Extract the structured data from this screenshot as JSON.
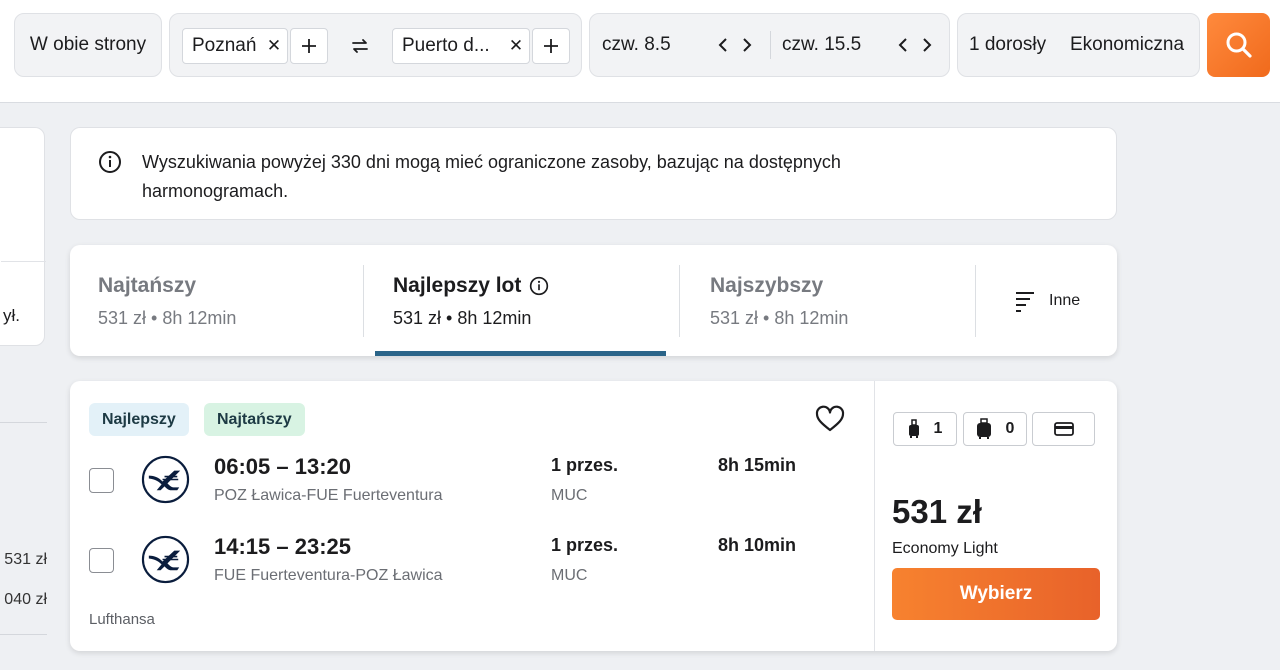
{
  "search": {
    "trip_type": "W obie strony",
    "origin": "Poznań",
    "destination": "Puerto d...",
    "depart_date": "czw. 8.5",
    "return_date": "czw. 15.5",
    "travelers": "1 dorosły",
    "cabin": "Ekonomiczna",
    "accent_color": "#f06a1c"
  },
  "left_panel": {
    "text": "ył.",
    "prices": [
      "531 zł",
      "040 zł"
    ]
  },
  "notice": {
    "icon": "info-icon",
    "text": "Wyszukiwania powyżej 330 dni mogą mieć ograniczone zasoby, bazując na dostępnych harmonogramach."
  },
  "sort_tabs": [
    {
      "title": "Najtańszy",
      "sub": "531 zł • 8h 12min",
      "active": false
    },
    {
      "title": "Najlepszy lot",
      "sub": "531 zł • 8h 12min",
      "active": true
    },
    {
      "title": "Najszybszy",
      "sub": "531 zł • 8h 12min",
      "active": false
    }
  ],
  "sort_more_label": "Inne",
  "result": {
    "badges": [
      "Najlepszy",
      "Najtańszy"
    ],
    "legs": [
      {
        "times": "06:05 – 13:20",
        "route": "POZ Ławica-FUE Fuerteventura",
        "stops": "1 przes.",
        "via": "MUC",
        "duration": "8h 15min"
      },
      {
        "times": "14:15 – 23:25",
        "route": "FUE Fuerteventura-POZ Ławica",
        "stops": "1 przes.",
        "via": "MUC",
        "duration": "8h 10min"
      }
    ],
    "airline": "Lufthansa",
    "bags": {
      "personal": "1",
      "carry_on": "0"
    },
    "price": "531 zł",
    "fare": "Economy Light",
    "select_label": "Wybierz"
  }
}
